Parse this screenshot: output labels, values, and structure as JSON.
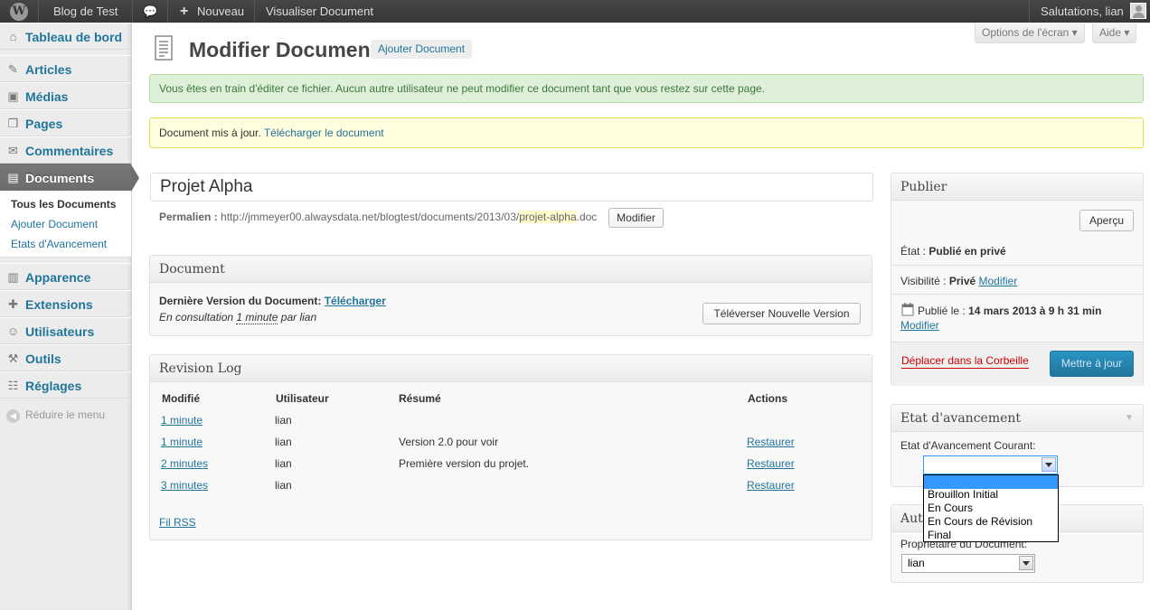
{
  "adminbar": {
    "logo_glyph": "W",
    "site_name": "Blog de Test",
    "comment_glyph": "💬",
    "new_label": "Nouveau",
    "view_label": "Visualiser Document",
    "greeting": "Salutations, lian"
  },
  "sidebar": {
    "items": [
      {
        "label": "Tableau de bord",
        "icon": "dashboard-icon",
        "glyph": "⌂"
      },
      {
        "label": "Articles",
        "icon": "pin-icon",
        "glyph": "✎"
      },
      {
        "label": "Médias",
        "icon": "media-icon",
        "glyph": "▣"
      },
      {
        "label": "Pages",
        "icon": "pages-icon",
        "glyph": "❐"
      },
      {
        "label": "Commentaires",
        "icon": "comments-icon",
        "glyph": "✉"
      },
      {
        "label": "Documents",
        "icon": "documents-icon",
        "glyph": "▤"
      },
      {
        "label": "Apparence",
        "icon": "appearance-icon",
        "glyph": "▥"
      },
      {
        "label": "Extensions",
        "icon": "plugins-icon",
        "glyph": "✚"
      },
      {
        "label": "Utilisateurs",
        "icon": "users-icon",
        "glyph": "☺"
      },
      {
        "label": "Outils",
        "icon": "tools-icon",
        "glyph": "⚒"
      },
      {
        "label": "Réglages",
        "icon": "settings-icon",
        "glyph": "☷"
      }
    ],
    "submenu": [
      "Tous les Documents",
      "Ajouter Document",
      "Etats d'Avancement"
    ],
    "collapse_label": "Réduire le menu",
    "collapse_glyph": "◀"
  },
  "screen_options": {
    "options_label": "Options de l'écran ▾",
    "help_label": "Aide ▾"
  },
  "header": {
    "title": "Modifier Document",
    "add_new": "Ajouter Document"
  },
  "notices": {
    "lock": "Vous êtes en train d'éditer ce fichier. Aucun autre utilisateur ne peut modifier ce document tant que vous restez sur cette page.",
    "updated": "Document mis à jour.",
    "download_link": "Télécharger le document"
  },
  "post": {
    "title": "Projet Alpha",
    "permalink_label": "Permalien :",
    "permalink_base": "http://jmmeyer00.alwaysdata.net/blogtest/documents/2013/03/",
    "permalink_slug": "projet-alpha",
    "permalink_ext": ".doc",
    "modify_button": "Modifier"
  },
  "document_box": {
    "title": "Document",
    "latest_label": "Dernière Version du Document:",
    "download": "Télécharger",
    "editing_prefix": "En consultation",
    "editing_time": "1 minute",
    "editing_suffix": "par lian",
    "upload_button": "Téléverser Nouvelle Version"
  },
  "revision_log": {
    "title": "Revision Log",
    "columns": [
      "Modifié",
      "Utilisateur",
      "Résumé",
      "Actions"
    ],
    "rows": [
      {
        "modified": "1 minute",
        "user": "lian",
        "summary": "",
        "action": ""
      },
      {
        "modified": "1 minute",
        "user": "lian",
        "summary": "Version 2.0 pour voir",
        "action": "Restaurer"
      },
      {
        "modified": "2 minutes",
        "user": "lian",
        "summary": "Première version du projet.",
        "action": "Restaurer"
      },
      {
        "modified": "3 minutes",
        "user": "lian",
        "summary": "",
        "action": "Restaurer"
      }
    ],
    "rss": "Fil RSS"
  },
  "publish": {
    "title": "Publier",
    "preview": "Aperçu",
    "status_label": "État :",
    "status_value": "Publié en privé",
    "visibility_label": "Visibilité :",
    "visibility_value": "Privé",
    "modify": "Modifier",
    "published_label": "Publié le :",
    "published_value": "14 mars 2013 à 9 h 31 min",
    "published_modify": "Modifier",
    "trash": "Déplacer dans la Corbeille",
    "update": "Mettre à jour"
  },
  "workflow": {
    "title": "Etat d'avancement",
    "current_label": "Etat d'Avancement Courant:",
    "selected": "",
    "options": [
      "",
      "Brouillon Initial",
      "En Cours",
      "En Cours de Révision",
      "Final"
    ]
  },
  "author": {
    "title_visible": "Aut",
    "owner_label": "Propriétaire du Document:",
    "owner_value": "lian"
  }
}
